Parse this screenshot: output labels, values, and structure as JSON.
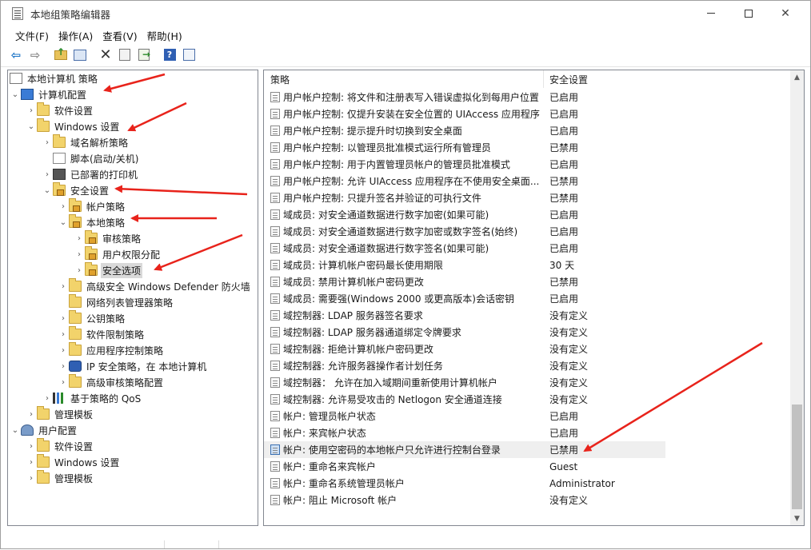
{
  "window": {
    "title": "本地组策略编辑器",
    "minimize_symbol": "—",
    "close_symbol": "✕"
  },
  "menubar": [
    "文件(F)",
    "操作(A)",
    "查看(V)",
    "帮助(H)"
  ],
  "toolbar": {
    "icons": [
      "back-icon",
      "forward-icon",
      "up-folder-icon",
      "show-hide-tree-icon",
      "delete-icon",
      "properties-icon",
      "export-list-icon",
      "help-icon",
      "view-icon"
    ],
    "help_glyph": "?"
  },
  "tree": {
    "root": "本地计算机 策略",
    "computer_config": "计算机配置",
    "software_settings": "软件设置",
    "windows_settings": "Windows 设置",
    "name_resolution": "域名解析策略",
    "scripts": "脚本(启动/关机)",
    "printers": "已部署的打印机",
    "security_settings": "安全设置",
    "account_policies": "帐户策略",
    "local_policies": "本地策略",
    "audit_policy": "审核策略",
    "user_rights": "用户权限分配",
    "security_options": "安全选项",
    "firewall": "高级安全 Windows Defender 防火墙",
    "network_list": "网络列表管理器策略",
    "public_key": "公钥策略",
    "software_restriction": "软件限制策略",
    "app_control": "应用程序控制策略",
    "ipsec": "IP 安全策略，在 本地计算机",
    "advanced_audit": "高级审核策略配置",
    "qos": "基于策略的 QoS",
    "admin_templates_c": "管理模板",
    "user_config": "用户配置",
    "u_software": "软件设置",
    "u_windows": "Windows 设置",
    "u_admin": "管理模板"
  },
  "list": {
    "col_policy": "策略",
    "col_setting": "安全设置",
    "rows": [
      {
        "policy": "用户帐户控制: 将文件和注册表写入错误虚拟化到每用户位置",
        "setting": "已启用"
      },
      {
        "policy": "用户帐户控制: 仅提升安装在安全位置的 UIAccess 应用程序",
        "setting": "已启用"
      },
      {
        "policy": "用户帐户控制: 提示提升时切换到安全桌面",
        "setting": "已启用"
      },
      {
        "policy": "用户帐户控制: 以管理员批准模式运行所有管理员",
        "setting": "已禁用"
      },
      {
        "policy": "用户帐户控制: 用于内置管理员帐户的管理员批准模式",
        "setting": "已启用"
      },
      {
        "policy": "用户帐户控制: 允许 UIAccess 应用程序在不使用安全桌面...",
        "setting": "已禁用"
      },
      {
        "policy": "用户帐户控制: 只提升签名并验证的可执行文件",
        "setting": "已禁用"
      },
      {
        "policy": "域成员: 对安全通道数据进行数字加密(如果可能)",
        "setting": "已启用"
      },
      {
        "policy": "域成员: 对安全通道数据进行数字加密或数字签名(始终)",
        "setting": "已启用"
      },
      {
        "policy": "域成员: 对安全通道数据进行数字签名(如果可能)",
        "setting": "已启用"
      },
      {
        "policy": "域成员: 计算机帐户密码最长使用期限",
        "setting": "30 天"
      },
      {
        "policy": "域成员: 禁用计算机帐户密码更改",
        "setting": "已禁用"
      },
      {
        "policy": "域成员: 需要强(Windows 2000 或更高版本)会话密钥",
        "setting": "已启用"
      },
      {
        "policy": "域控制器: LDAP 服务器签名要求",
        "setting": "没有定义"
      },
      {
        "policy": "域控制器: LDAP 服务器通道绑定令牌要求",
        "setting": "没有定义"
      },
      {
        "policy": "域控制器: 拒绝计算机帐户密码更改",
        "setting": "没有定义"
      },
      {
        "policy": "域控制器: 允许服务器操作者计划任务",
        "setting": "没有定义"
      },
      {
        "policy": "域控制器： 允许在加入域期间重新使用计算机帐户",
        "setting": "没有定义"
      },
      {
        "policy": "域控制器: 允许易受攻击的 Netlogon 安全通道连接",
        "setting": "没有定义"
      },
      {
        "policy": "帐户: 管理员帐户状态",
        "setting": "已启用"
      },
      {
        "policy": "帐户: 来宾帐户状态",
        "setting": "已启用"
      },
      {
        "policy": "帐户: 使用空密码的本地帐户只允许进行控制台登录",
        "setting": "已禁用"
      },
      {
        "policy": "帐户: 重命名来宾帐户",
        "setting": "Guest"
      },
      {
        "policy": "帐户: 重命名系统管理员帐户",
        "setting": "Administrator"
      },
      {
        "policy": "帐户: 阻止 Microsoft 帐户",
        "setting": "没有定义"
      }
    ]
  },
  "colors": {
    "annotation_arrow": "#e8231b",
    "selected_bg": "#d9d9d9",
    "highlight_row": "#efefef"
  }
}
